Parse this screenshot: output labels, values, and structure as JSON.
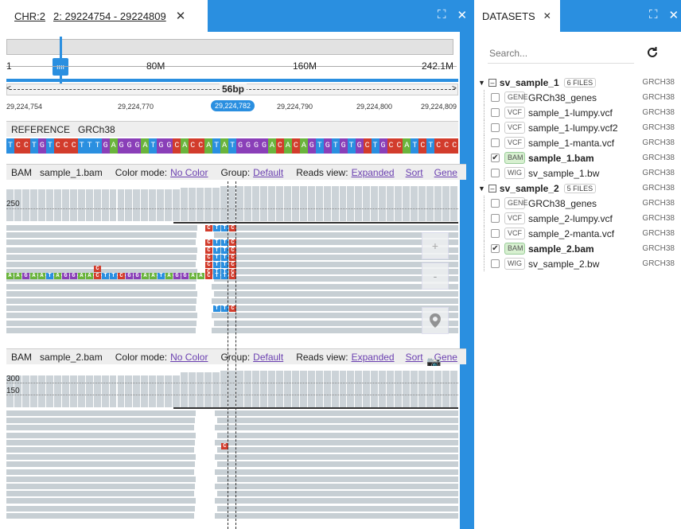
{
  "browser": {
    "tab_chr": "CHR:2",
    "tab_range": "2: 29224754 - 29224809",
    "ruler": {
      "start": "1",
      "t80": "80M",
      "t160": "160M",
      "end": "242.1M"
    },
    "span_label": "56bp",
    "coords": [
      "29,224,754",
      "29,224,770",
      "29,224,782",
      "29,224,790",
      "29,224,800",
      "29,224,809"
    ],
    "reference": {
      "label": "REFERENCE",
      "genome": "GRCh38",
      "sequence": "TCCTGTCCCTTTGAGGGATGGCACCATATGGGGACACAGTGTGTGCTGCCATCTCCC"
    },
    "track1": {
      "type": "BAM",
      "name": "sample_1.bam",
      "color_label": "Color mode:",
      "color_value": "No Color",
      "group_label": "Group:",
      "group_value": "Default",
      "reads_label": "Reads view:",
      "reads_value": "Expanded",
      "sort": "Sort",
      "gene": "Gene",
      "cov_ticks": [
        "250"
      ]
    },
    "track2": {
      "type": "BAM",
      "name": "sample_2.bam",
      "color_label": "Color mode:",
      "color_value": "No Color",
      "group_label": "Group:",
      "group_value": "Default",
      "reads_label": "Reads view:",
      "reads_value": "Expanded",
      "sort": "Sort",
      "gene": "Gene",
      "cov_ticks": [
        "300",
        "150"
      ]
    },
    "softclip_seq": "AAGAATAGGAACTTCGGAATAGGAACTTC",
    "controls": {
      "zoom_in": "+",
      "zoom_out": "-"
    }
  },
  "datasets": {
    "tab_label": "DATASETS",
    "search_placeholder": "Search...",
    "groups": [
      {
        "name": "sv_sample_1",
        "files": "6 FILES",
        "genome": "GRCH38",
        "items": [
          {
            "badge": "GENE",
            "name": "GRCh38_genes",
            "genome": "GRCH38",
            "checked": false
          },
          {
            "badge": "VCF",
            "name": "sample_1-lumpy.vcf",
            "genome": "GRCH38",
            "checked": false
          },
          {
            "badge": "VCF",
            "name": "sample_1-lumpy.vcf2",
            "genome": "GRCH38",
            "checked": false
          },
          {
            "badge": "VCF",
            "name": "sample_1-manta.vcf",
            "genome": "GRCH38",
            "checked": false
          },
          {
            "badge": "BAM",
            "name": "sample_1.bam",
            "genome": "GRCH38",
            "checked": true
          },
          {
            "badge": "WIG",
            "name": "sv_sample_1.bw",
            "genome": "GRCH38",
            "checked": false
          }
        ]
      },
      {
        "name": "sv_sample_2",
        "files": "5 FILES",
        "genome": "GRCH38",
        "items": [
          {
            "badge": "GENE",
            "name": "GRCh38_genes",
            "genome": "GRCH38",
            "checked": false
          },
          {
            "badge": "VCF",
            "name": "sample_2-lumpy.vcf",
            "genome": "GRCH38",
            "checked": false
          },
          {
            "badge": "VCF",
            "name": "sample_2-manta.vcf",
            "genome": "GRCH38",
            "checked": false
          },
          {
            "badge": "BAM",
            "name": "sample_2.bam",
            "genome": "GRCH38",
            "checked": true
          },
          {
            "badge": "WIG",
            "name": "sv_sample_2.bw",
            "genome": "GRCH38",
            "checked": false
          }
        ]
      }
    ]
  },
  "colors": {
    "accent": "#2a8fe0",
    "A": "#6ab43c",
    "C": "#d23c2c",
    "G": "#8a3fb8",
    "T": "#2a8fe0"
  }
}
